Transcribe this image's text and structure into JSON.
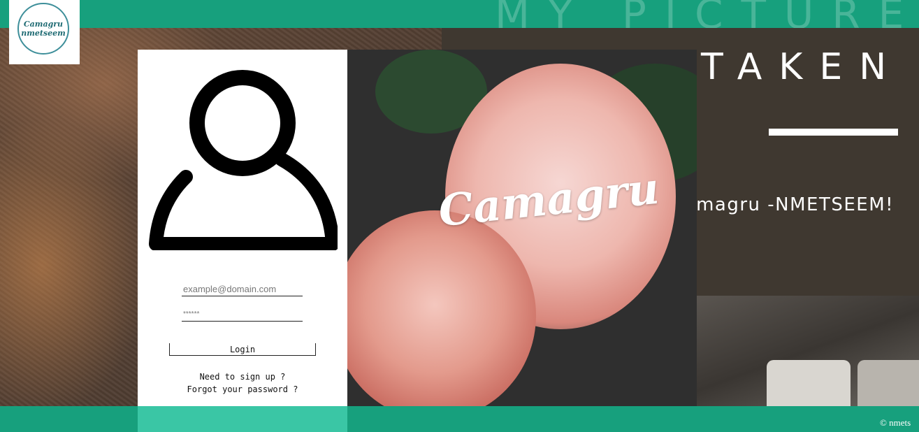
{
  "header": {
    "banner_text": "MY PICTURE",
    "logo_line1": "Camagru",
    "logo_line2": "nmetseem"
  },
  "login": {
    "email_placeholder": "example@domain.com",
    "password_placeholder": "******",
    "login_label": "Login",
    "signup_link": "Need to sign up ?",
    "forgot_link": "Forgot your password ?"
  },
  "photo": {
    "title": "Camagru"
  },
  "hero": {
    "taken_text": "TAKEN",
    "welcome_text": "Camagru -NMETSEEM!"
  },
  "footer": {
    "copyright": "© nmets"
  },
  "colors": {
    "accent": "#17a07d",
    "accent_light": "#3ac6a5"
  }
}
